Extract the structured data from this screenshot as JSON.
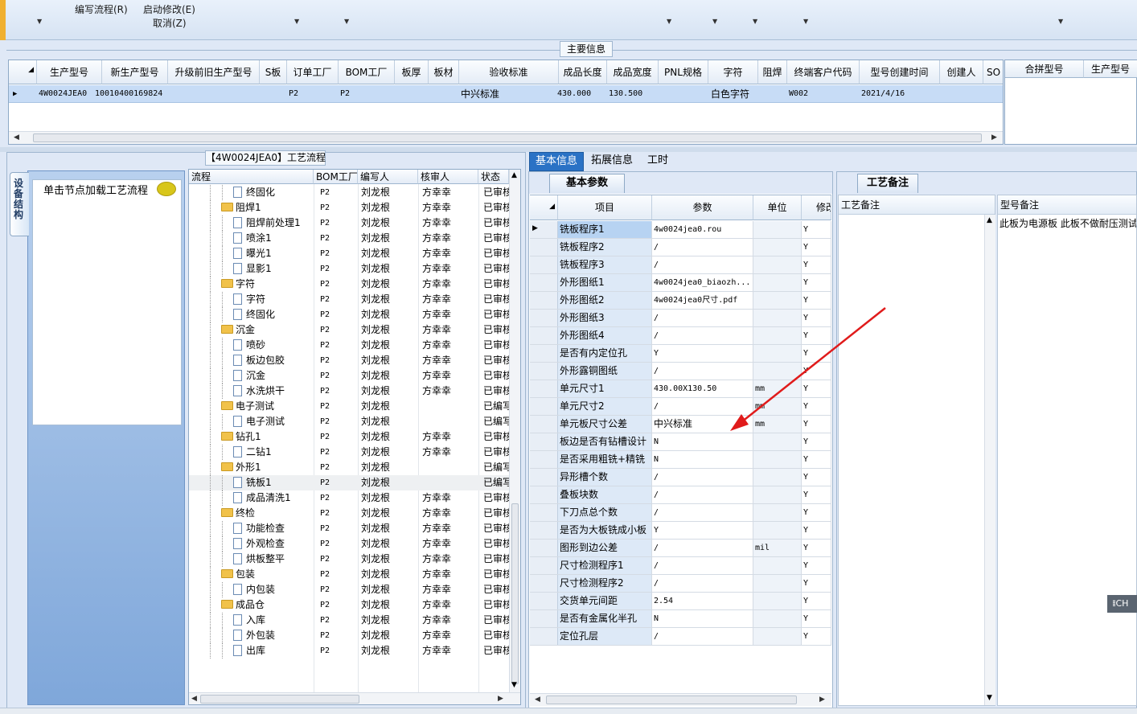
{
  "toolbar": {
    "items": [
      {
        "label": "编写流程(R)"
      },
      {
        "label": "启动修改(E)"
      },
      {
        "label": "取消(Z)"
      }
    ]
  },
  "main_info": {
    "title": "主要信息",
    "columns": [
      "生产型号",
      "新生产型号",
      "升级前旧生产型号",
      "S板",
      "订单工厂",
      "BOM工厂",
      "板厚",
      "板材",
      "验收标准",
      "成品长度",
      "成品宽度",
      "PNL规格",
      "字符",
      "阻焊",
      "终端客户代码",
      "型号创建时间",
      "创建人",
      "SO"
    ],
    "row": {
      "model": "4W0024JEA0",
      "new_model": "10010400169824",
      "order_factory": "P2",
      "bom_factory": "P2",
      "acceptance": "中兴标准",
      "length": "430.000",
      "width": "130.500",
      "char": "白色字符",
      "customer_code": "W002",
      "created": "2021/4/16"
    },
    "merge_columns": [
      "合拼型号",
      "生产型号"
    ]
  },
  "process_flow": {
    "title": "【4W0024JEA0】工艺流程",
    "side_tab": "设备结构",
    "hint": "单击节点加载工艺流程",
    "columns": [
      "流程",
      "BOM工厂",
      "编写人",
      "核审人",
      "状态"
    ],
    "rows": [
      {
        "name": "终固化",
        "level": 2,
        "bom": "P2",
        "writer": "刘龙根",
        "reviewer": "方幸幸",
        "status": "已审核"
      },
      {
        "name": "阻焊1",
        "level": 1,
        "bom": "P2",
        "writer": "刘龙根",
        "reviewer": "方幸幸",
        "status": "已审核"
      },
      {
        "name": "阻焊前处理1",
        "level": 2,
        "bom": "P2",
        "writer": "刘龙根",
        "reviewer": "方幸幸",
        "status": "已审核"
      },
      {
        "name": "喷涂1",
        "level": 2,
        "bom": "P2",
        "writer": "刘龙根",
        "reviewer": "方幸幸",
        "status": "已审核"
      },
      {
        "name": "曝光1",
        "level": 2,
        "bom": "P2",
        "writer": "刘龙根",
        "reviewer": "方幸幸",
        "status": "已审核"
      },
      {
        "name": "显影1",
        "level": 2,
        "bom": "P2",
        "writer": "刘龙根",
        "reviewer": "方幸幸",
        "status": "已审核"
      },
      {
        "name": "字符",
        "level": 1,
        "bom": "P2",
        "writer": "刘龙根",
        "reviewer": "方幸幸",
        "status": "已审核"
      },
      {
        "name": "字符",
        "level": 2,
        "bom": "P2",
        "writer": "刘龙根",
        "reviewer": "方幸幸",
        "status": "已审核"
      },
      {
        "name": "终固化",
        "level": 2,
        "bom": "P2",
        "writer": "刘龙根",
        "reviewer": "方幸幸",
        "status": "已审核"
      },
      {
        "name": "沉金",
        "level": 1,
        "bom": "P2",
        "writer": "刘龙根",
        "reviewer": "方幸幸",
        "status": "已审核"
      },
      {
        "name": "喷砂",
        "level": 2,
        "bom": "P2",
        "writer": "刘龙根",
        "reviewer": "方幸幸",
        "status": "已审核"
      },
      {
        "name": "板边包胶",
        "level": 2,
        "bom": "P2",
        "writer": "刘龙根",
        "reviewer": "方幸幸",
        "status": "已审核"
      },
      {
        "name": "沉金",
        "level": 2,
        "bom": "P2",
        "writer": "刘龙根",
        "reviewer": "方幸幸",
        "status": "已审核"
      },
      {
        "name": "水洗烘干",
        "level": 2,
        "bom": "P2",
        "writer": "刘龙根",
        "reviewer": "方幸幸",
        "status": "已审核"
      },
      {
        "name": "电子测试",
        "level": 1,
        "bom": "P2",
        "writer": "刘龙根",
        "reviewer": "",
        "status": "已编写"
      },
      {
        "name": "电子测试",
        "level": 2,
        "bom": "P2",
        "writer": "刘龙根",
        "reviewer": "",
        "status": "已编写"
      },
      {
        "name": "钻孔1",
        "level": 1,
        "bom": "P2",
        "writer": "刘龙根",
        "reviewer": "方幸幸",
        "status": "已审核"
      },
      {
        "name": "二钻1",
        "level": 2,
        "bom": "P2",
        "writer": "刘龙根",
        "reviewer": "方幸幸",
        "status": "已审核"
      },
      {
        "name": "外形1",
        "level": 1,
        "bom": "P2",
        "writer": "刘龙根",
        "reviewer": "",
        "status": "已编写"
      },
      {
        "name": "铣板1",
        "level": 2,
        "bom": "P2",
        "writer": "刘龙根",
        "reviewer": "",
        "status": "已编写",
        "selected": true
      },
      {
        "name": "成品清洗1",
        "level": 2,
        "bom": "P2",
        "writer": "刘龙根",
        "reviewer": "方幸幸",
        "status": "已审核"
      },
      {
        "name": "终检",
        "level": 1,
        "bom": "P2",
        "writer": "刘龙根",
        "reviewer": "方幸幸",
        "status": "已审核"
      },
      {
        "name": "功能检查",
        "level": 2,
        "bom": "P2",
        "writer": "刘龙根",
        "reviewer": "方幸幸",
        "status": "已审核"
      },
      {
        "name": "外观检查",
        "level": 2,
        "bom": "P2",
        "writer": "刘龙根",
        "reviewer": "方幸幸",
        "status": "已审核"
      },
      {
        "name": "烘板整平",
        "level": 2,
        "bom": "P2",
        "writer": "刘龙根",
        "reviewer": "方幸幸",
        "status": "已审核"
      },
      {
        "name": "包装",
        "level": 1,
        "bom": "P2",
        "writer": "刘龙根",
        "reviewer": "方幸幸",
        "status": "已审核"
      },
      {
        "name": "内包装",
        "level": 2,
        "bom": "P2",
        "writer": "刘龙根",
        "reviewer": "方幸幸",
        "status": "已审核"
      },
      {
        "name": "成品仓",
        "level": 1,
        "bom": "P2",
        "writer": "刘龙根",
        "reviewer": "方幸幸",
        "status": "已审核"
      },
      {
        "name": "入库",
        "level": 2,
        "bom": "P2",
        "writer": "刘龙根",
        "reviewer": "方幸幸",
        "status": "已审核"
      },
      {
        "name": "外包装",
        "level": 2,
        "bom": "P2",
        "writer": "刘龙根",
        "reviewer": "方幸幸",
        "status": "已审核"
      },
      {
        "name": "出库",
        "level": 2,
        "bom": "P2",
        "writer": "刘龙根",
        "reviewer": "方幸幸",
        "status": "已审核"
      }
    ]
  },
  "right_tabs": [
    "基本信息",
    "拓展信息",
    "工时"
  ],
  "params": {
    "tab": "基本参数",
    "columns": [
      "项目",
      "参数",
      "单位",
      "修改"
    ],
    "rows": [
      {
        "item": "铣板程序1",
        "value": "4w0024jea0.rou",
        "unit": "",
        "flag": "Y"
      },
      {
        "item": "铣板程序2",
        "value": "/",
        "unit": "",
        "flag": "Y"
      },
      {
        "item": "铣板程序3",
        "value": "/",
        "unit": "",
        "flag": "Y"
      },
      {
        "item": "外形图纸1",
        "value": "4w0024jea0_biaozh...",
        "unit": "",
        "flag": "Y"
      },
      {
        "item": "外形图纸2",
        "value": "4w0024jea0尺寸.pdf",
        "unit": "",
        "flag": "Y"
      },
      {
        "item": "外形图纸3",
        "value": "/",
        "unit": "",
        "flag": "Y"
      },
      {
        "item": "外形图纸4",
        "value": "/",
        "unit": "",
        "flag": "Y"
      },
      {
        "item": "是否有内定位孔",
        "value": "Y",
        "unit": "",
        "flag": "Y"
      },
      {
        "item": "外形露铜图纸",
        "value": "/",
        "unit": "",
        "flag": "Y"
      },
      {
        "item": "单元尺寸1",
        "value": "430.00X130.50",
        "unit": "mm",
        "flag": "Y"
      },
      {
        "item": "单元尺寸2",
        "value": "/",
        "unit": "mm",
        "flag": "Y"
      },
      {
        "item": "单元板尺寸公差",
        "value": "中兴标准",
        "unit": "mm",
        "flag": "Y"
      },
      {
        "item": "板边是否有钻槽设计",
        "value": "N",
        "unit": "",
        "flag": "Y"
      },
      {
        "item": "是否采用粗铣+精铣",
        "value": "N",
        "unit": "",
        "flag": "Y"
      },
      {
        "item": "异形槽个数",
        "value": "/",
        "unit": "",
        "flag": "Y"
      },
      {
        "item": "叠板块数",
        "value": "/",
        "unit": "",
        "flag": "Y"
      },
      {
        "item": "下刀点总个数",
        "value": "/",
        "unit": "",
        "flag": "Y"
      },
      {
        "item": "是否为大板铣成小板",
        "value": "Y",
        "unit": "",
        "flag": "Y"
      },
      {
        "item": "图形到边公差",
        "value": "/",
        "unit": "mil",
        "flag": "Y"
      },
      {
        "item": "尺寸检测程序1",
        "value": "/",
        "unit": "",
        "flag": "Y"
      },
      {
        "item": "尺寸检测程序2",
        "value": "/",
        "unit": "",
        "flag": "Y"
      },
      {
        "item": "交货单元间距",
        "value": "2.54",
        "unit": "",
        "flag": "Y"
      },
      {
        "item": "是否有金属化半孔",
        "value": "N",
        "unit": "",
        "flag": "Y"
      },
      {
        "item": "定位孔层",
        "value": "/",
        "unit": "",
        "flag": "Y"
      }
    ]
  },
  "remarks": {
    "tab": "工艺备注",
    "process_label": "工艺备注",
    "model_label": "型号备注",
    "model_text": "此板为电源板 此板不做耐压测试"
  },
  "ime": {
    "label": "CH"
  },
  "colors": {
    "accent": "#2a72c5",
    "selection": "#c7dcf6",
    "annotation_arrow": "#e01b1b"
  }
}
